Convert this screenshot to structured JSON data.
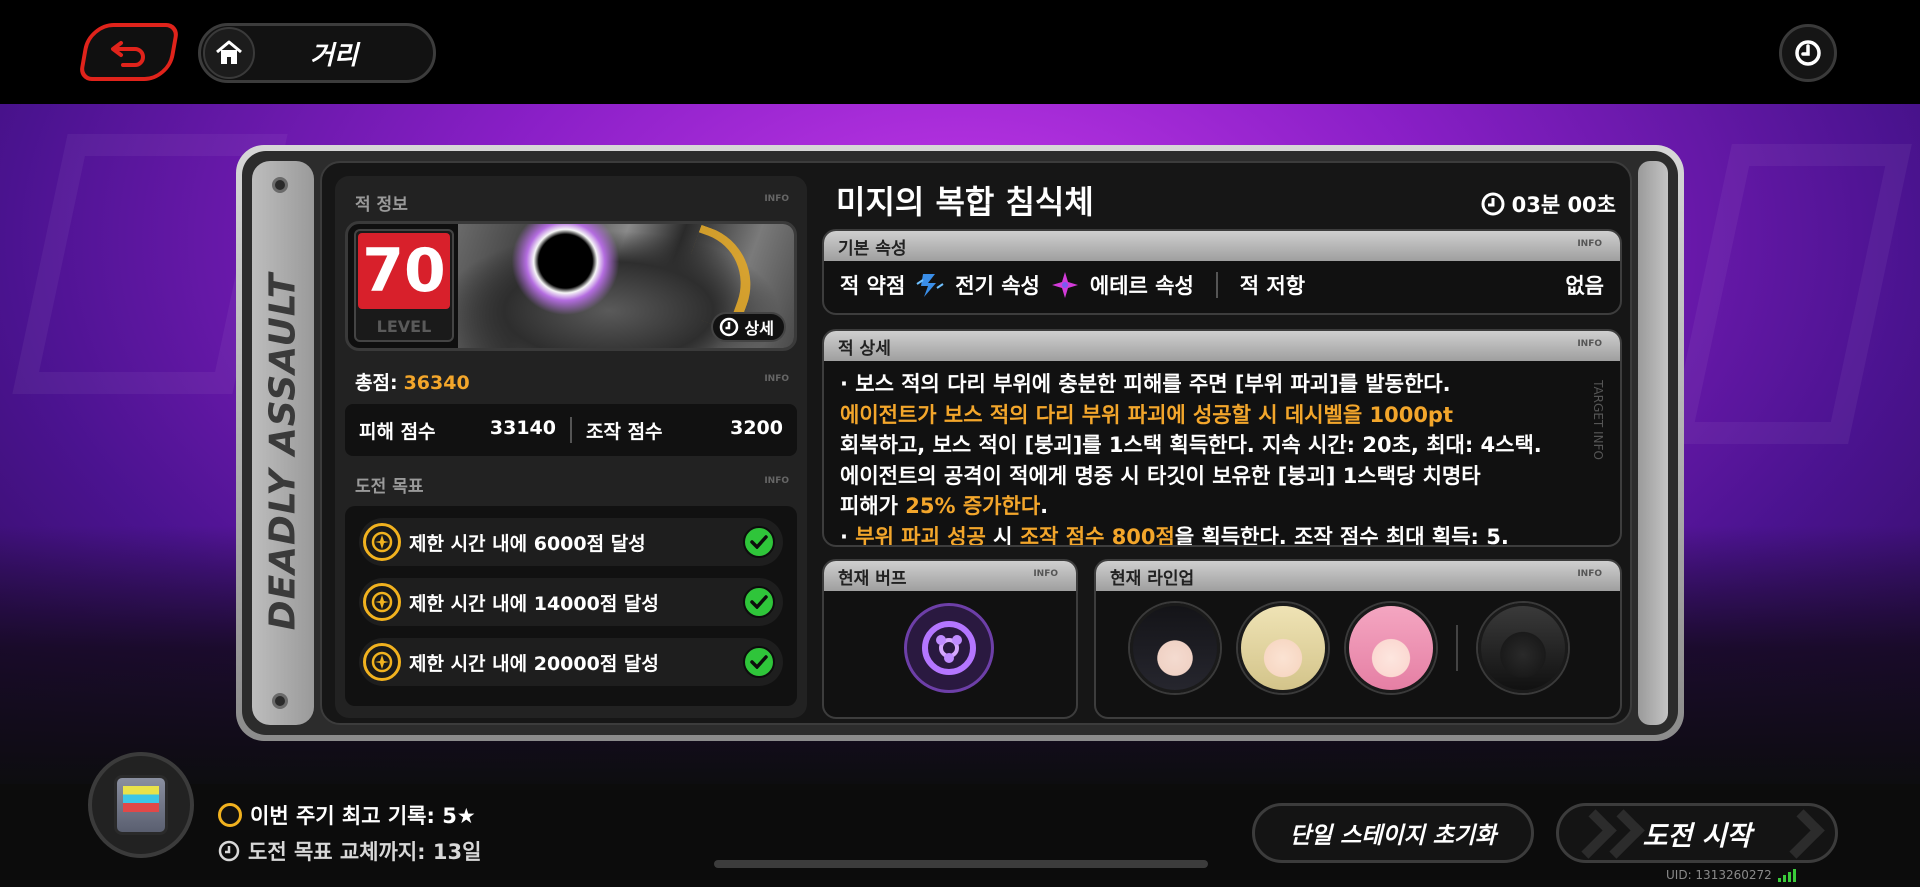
{
  "topbar": {
    "breadcrumb_label": "거리"
  },
  "side_strip": {
    "title": "DEADLY ASSAULT",
    "target_info": "TARGET INFO"
  },
  "enemy_info": {
    "section_title": "적 정보",
    "info_tag": "INFO",
    "level": "70",
    "level_label": "LEVEL",
    "detail_button": "상세",
    "total_label": "총점:",
    "total_value": "36340",
    "damage_score_label": "피해 점수",
    "damage_score_value": "33140",
    "control_score_label": "조작 점수",
    "control_score_value": "3200"
  },
  "challenge": {
    "section_title": "도전 목표",
    "info_tag": "INFO",
    "goals": [
      {
        "text": "제한 시간 내에 6000점 달성",
        "done": true
      },
      {
        "text": "제한 시간 내에 14000점 달성",
        "done": true
      },
      {
        "text": "제한 시간 내에 20000점 달성",
        "done": true
      }
    ]
  },
  "boss": {
    "name": "미지의 복합 침식체",
    "time_limit": "03분 00초"
  },
  "attributes": {
    "title": "기본 속성",
    "info_tag": "INFO",
    "weakness_label": "적 약점",
    "weakness_1": "전기 속성",
    "weakness_2": "에테르 속성",
    "resist_label": "적 저항",
    "resist_value": "없음"
  },
  "details": {
    "title": "적 상세",
    "info_tag": "INFO",
    "line1": "· 보스 적의 다리 부위에 충분한 피해를 주면 [부위 파괴]를 발동한다.",
    "line2_hl": "에이전트가 보스 적의 다리 부위 파괴에 성공할 시  데시벨을 1000pt",
    "line3": "회복하고, 보스 적이 [붕괴]를 1스택 획득한다. 지속 시간: 20초, 최대: 4스택.",
    "line4": "에이전트의 공격이 적에게 명중 시 타깃이 보유한 [붕괴] 1스택당 치명타",
    "line5_a": "피해가 ",
    "line5_hl": "25% 증가한다",
    "line5_b": ".",
    "line6_a": "· ",
    "line6_hl1": "부위 파괴 성공",
    "line6_b": " 시 ",
    "line6_hl2": "조작 점수 800점",
    "line6_c": "을 획득한다. 조작 점수 최대 획득: 5."
  },
  "buff": {
    "title": "현재 버프",
    "info_tag": "INFO"
  },
  "lineup": {
    "title": "현재 라인업",
    "info_tag": "INFO"
  },
  "bottom": {
    "record_label": "이번 주기 최고 기록: 5★",
    "reset_label": "도전 목표 교체까지: 13일",
    "reset_stage_button": "단일 스테이지 초기화",
    "start_button": "도전 시작",
    "uid": "UID: 1313260272"
  },
  "colors": {
    "accent_orange": "#f3a62b",
    "level_red": "#d8202b",
    "check_green": "#2fc53a",
    "back_red": "#e0231b",
    "purple_bg": "#8a1fc7"
  }
}
